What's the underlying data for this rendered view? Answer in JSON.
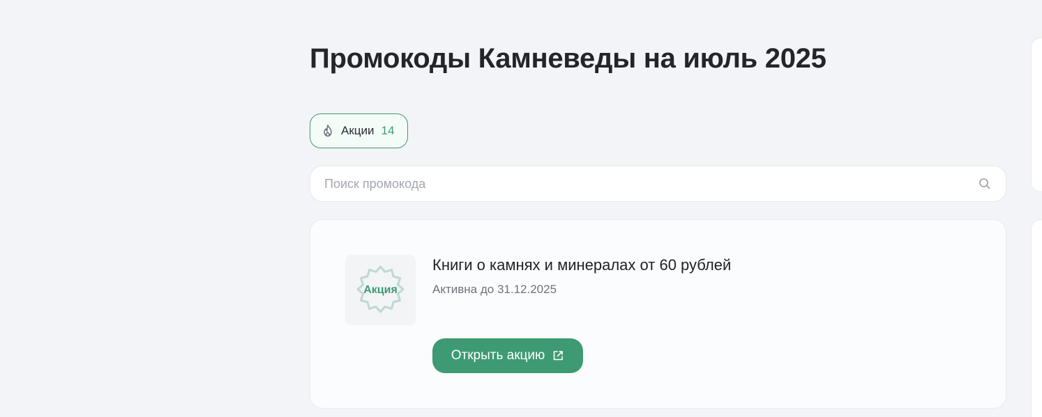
{
  "page": {
    "title": "Промокоды Камневеды на июль 2025"
  },
  "filter": {
    "label": "Акции",
    "count": "14",
    "icon": "fire-icon",
    "accent_color": "#3d9a72"
  },
  "search": {
    "value": "",
    "placeholder": "Поиск промокода",
    "icon": "search-icon"
  },
  "promos": [
    {
      "badge_text": "Акция",
      "title": "Книги о камнях и минералах от 60 рублей",
      "expiry": "Активна до 31.12.2025",
      "button_label": "Открыть акцию",
      "button_icon": "external-link-icon",
      "button_color": "#3d9a72"
    }
  ]
}
